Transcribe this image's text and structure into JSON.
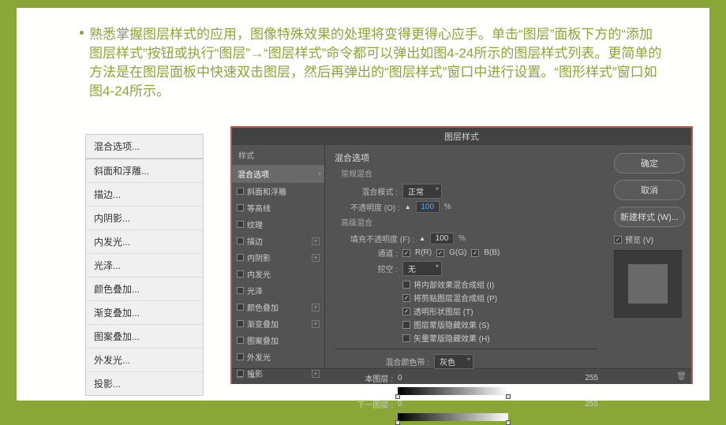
{
  "paragraph": "熟悉掌握图层样式的应用，图像特殊效果的处理将变得更得心应手。单击“图层”面板下方的“添加图层样式”按钮或执行“图层”→“图层样式”命令都可以弹出如图4-24所示的图层样式列表。更简单的方法是在图层面板中快速双击图层，然后再弹出的“图层样式”窗口中进行设置。“图形样式”窗口如图4-24所示。",
  "menu": {
    "items": [
      "混合选项...",
      "斜面和浮雕...",
      "描边...",
      "内阴影...",
      "内发光...",
      "光泽...",
      "颜色叠加...",
      "渐变叠加...",
      "图案叠加...",
      "外发光...",
      "投影..."
    ]
  },
  "dialog": {
    "title": "图层样式",
    "styles_header": "样式",
    "style_items": [
      {
        "label": "混合选项",
        "selected": true,
        "cb": false,
        "plus": false
      },
      {
        "label": "斜面和浮雕",
        "selected": false,
        "cb": true,
        "plus": false
      },
      {
        "label": "等高线",
        "selected": false,
        "cb": true,
        "plus": false
      },
      {
        "label": "纹理",
        "selected": false,
        "cb": true,
        "plus": false
      },
      {
        "label": "描边",
        "selected": false,
        "cb": true,
        "plus": true
      },
      {
        "label": "内阴影",
        "selected": false,
        "cb": true,
        "plus": true
      },
      {
        "label": "内发光",
        "selected": false,
        "cb": true,
        "plus": false
      },
      {
        "label": "光泽",
        "selected": false,
        "cb": true,
        "plus": false
      },
      {
        "label": "颜色叠加",
        "selected": false,
        "cb": true,
        "plus": true
      },
      {
        "label": "渐变叠加",
        "selected": false,
        "cb": true,
        "plus": true
      },
      {
        "label": "图案叠加",
        "selected": false,
        "cb": true,
        "plus": false
      },
      {
        "label": "外发光",
        "selected": false,
        "cb": true,
        "plus": false
      },
      {
        "label": "投影",
        "selected": false,
        "cb": true,
        "plus": true
      }
    ],
    "main": {
      "section": "混合选项",
      "general": "常规混合",
      "blend_mode_label": "混合模式 :",
      "blend_mode_value": "正常",
      "opacity_label": "不透明度 (O) :",
      "opacity_value": "100",
      "advanced": "高级混合",
      "fill_label": "填充不透明度 (F) :",
      "fill_value": "100",
      "channels_label": "通道 :",
      "ch_r": "R(R)",
      "ch_g": "G(G)",
      "ch_b": "B(B)",
      "knockout_label": "挖空 :",
      "knockout_value": "无",
      "adv_checks": [
        {
          "label": "将内部效果混合成组 (I)",
          "on": false
        },
        {
          "label": "将剪贴图层混合成组 (P)",
          "on": true
        },
        {
          "label": "透明形状图层 (T)",
          "on": true
        },
        {
          "label": "图层蒙版隐藏效果 (S)",
          "on": false
        },
        {
          "label": "矢量蒙版隐藏效果 (H)",
          "on": false
        }
      ],
      "blendif_label": "混合颜色带 :",
      "blendif_value": "灰色",
      "this_layer": "本图层 :",
      "this_min": "0",
      "this_max": "255",
      "under_layer": "下一图层 :",
      "under_min": "0",
      "under_max": "255"
    },
    "buttons": {
      "ok": "确定",
      "cancel": "取消",
      "new": "新建样式 (W)...",
      "preview": "预览 (V)"
    }
  }
}
